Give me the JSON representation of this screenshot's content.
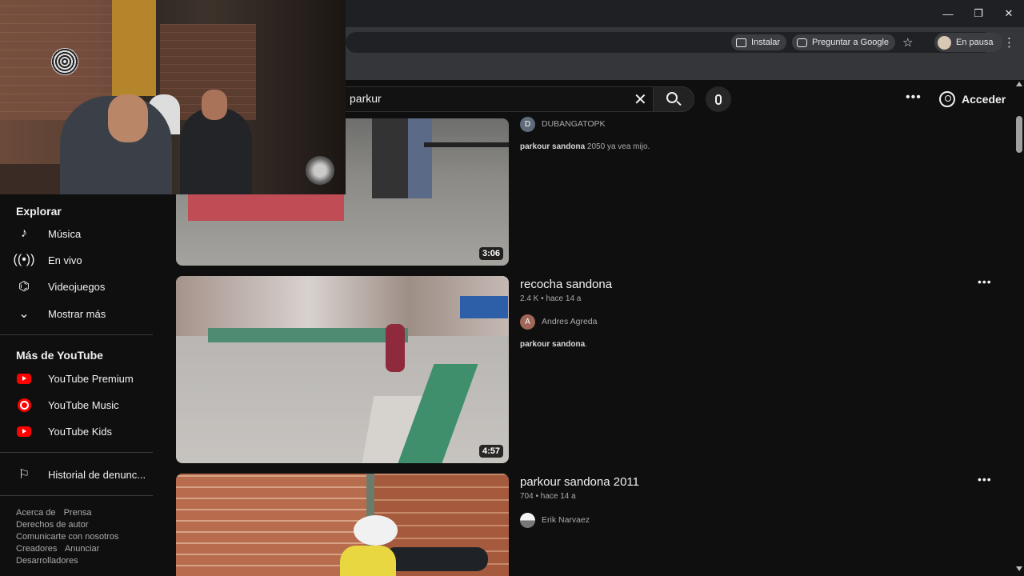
{
  "browser": {
    "window_controls": {
      "minimize": "—",
      "restore": "❐",
      "close": "✕"
    },
    "chips": {
      "install": "Instalar",
      "ask_google": "Preguntar a Google"
    },
    "profile_status": "En pausa",
    "star_glyph": "☆",
    "menu_glyph": "⋮"
  },
  "header": {
    "search_query": "parkur",
    "clear_glyph": "✕",
    "more_glyph": "•••",
    "sign_in": "Acceder"
  },
  "sidebar": {
    "explore_title": "Explorar",
    "explore_items": [
      {
        "label": "Música",
        "icon": "music-note-icon"
      },
      {
        "label": "En vivo",
        "icon": "live-broadcast-icon"
      },
      {
        "label": "Videojuegos",
        "icon": "gamepad-icon"
      },
      {
        "label": "Mostrar más",
        "icon": "chevron-down-icon"
      }
    ],
    "more_title": "Más de YouTube",
    "more_items": [
      {
        "label": "YouTube Premium",
        "icon": "youtube-premium-icon"
      },
      {
        "label": "YouTube Music",
        "icon": "youtube-music-icon"
      },
      {
        "label": "YouTube Kids",
        "icon": "youtube-kids-icon"
      }
    ],
    "report_history": "Historial de denunc...",
    "footer": {
      "about": "Acerca de",
      "press": "Prensa",
      "copyright": "Derechos de autor",
      "contact": "Comunicarte con nosotros",
      "creators": "Creadores",
      "advertise": "Anunciar",
      "developers": "Desarrolladores"
    }
  },
  "results": [
    {
      "title": "",
      "duration": "3:06",
      "channel": "DUBANGATOPK",
      "channel_initial": "D",
      "channel_color": "#5f6b7a",
      "desc_bold": "parkour sandona",
      "desc_rest": " 2050 ya vea mijo."
    },
    {
      "title": "recocha sandona",
      "views": "2.4 K",
      "age": "hace 14 a",
      "duration": "4:57",
      "channel": "Andres Agreda",
      "channel_initial": "A",
      "channel_color": "#a1665a",
      "desc_bold": "parkour sandona",
      "desc_rest": "."
    },
    {
      "title": "parkour sandona 2011",
      "views": "704",
      "age": "hace 14 a",
      "channel": "Erik Narvaez",
      "channel_initial": "",
      "channel_color": "#e6e6e6"
    }
  ],
  "separator": "•"
}
